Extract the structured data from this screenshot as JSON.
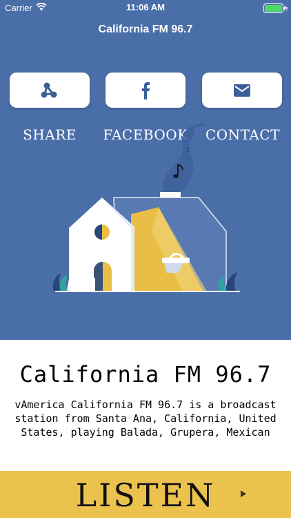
{
  "status_bar": {
    "carrier": "Carrier",
    "time": "11:06 AM"
  },
  "nav": {
    "title": "California FM 96.7"
  },
  "actions": [
    {
      "label": "SHARE",
      "icon": "share-icon"
    },
    {
      "label": "FACEBOOK",
      "icon": "facebook-icon"
    },
    {
      "label": "CONTACT",
      "icon": "mail-icon"
    }
  ],
  "station": {
    "name": "California FM 96.7",
    "description": "vAmerica California FM 96.7 is a broadcast station from Santa Ana, California, United States, playing Balada, Grupera, Mexican"
  },
  "listen": {
    "label": "LISTEN",
    "icon": "play-icon"
  },
  "colors": {
    "header_bg": "#4a6ea8",
    "listen_bg": "#ecc24f",
    "icon_blue": "#3b5f96"
  }
}
